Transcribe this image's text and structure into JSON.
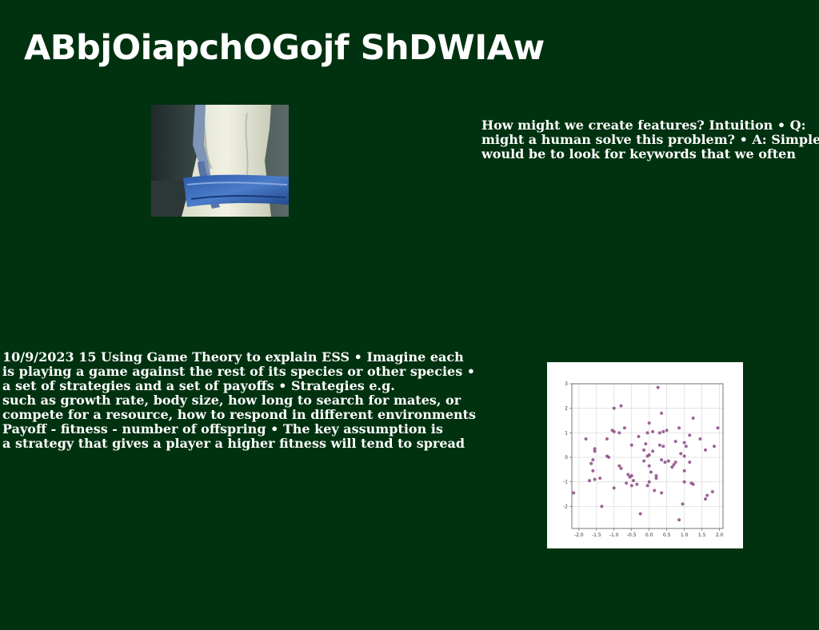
{
  "title": "ABbjOiapchOGojf ShDWIAw",
  "photo": {
    "icon": "photo-figure-white-robe-blue-fabric"
  },
  "text_right": {
    "lines": [
      "How might we create features? Intuition • Q:",
      "might a human solve this problem? • A: Simple",
      "would be to look for keywords that we often"
    ]
  },
  "text_left": {
    "lines": [
      "10/9/2023 15 Using Game Theory to explain ESS • Imagine each",
      "is playing a game against the rest of its species or other species •",
      "a set of strategies and a set of payoffs • Strategies e.g.",
      "such as growth rate, body size, how long to search for mates, or",
      "compete for a resource, how to respond in different environments",
      "Payoff - fitness - number of offspring • The key assumption is",
      "a strategy that gives a player a higher fitness will tend to spread"
    ]
  },
  "colors": {
    "background": "#013210",
    "point": "#8b4a86",
    "text": "#ffffff"
  },
  "chart_data": {
    "type": "scatter",
    "xlim": [
      -2.2,
      2.1
    ],
    "ylim": [
      -2.9,
      3.0
    ],
    "xticks": [
      "-2.0",
      "-1.5",
      "-1.0",
      "-0.5",
      "0.0",
      "0.5",
      "1.0",
      "1.5",
      "2.0"
    ],
    "xtick_values": [
      -2.0,
      -1.5,
      -1.0,
      -0.5,
      0.0,
      0.5,
      1.0,
      1.5,
      2.0
    ],
    "yticks": [
      "3",
      "2",
      "1",
      "0",
      "-1",
      "-2"
    ],
    "ytick_values": [
      3,
      2,
      1,
      0,
      -1,
      -2
    ],
    "grid": true,
    "points": [
      [
        0.25,
        2.85
      ],
      [
        -0.8,
        2.1
      ],
      [
        -1.0,
        2.0
      ],
      [
        0.35,
        1.8
      ],
      [
        1.25,
        1.6
      ],
      [
        0.0,
        1.4
      ],
      [
        -1.05,
        1.1
      ],
      [
        -0.7,
        1.2
      ],
      [
        0.85,
        1.2
      ],
      [
        1.95,
        1.2
      ],
      [
        0.1,
        1.05
      ],
      [
        0.4,
        1.05
      ],
      [
        0.5,
        1.1
      ],
      [
        0.3,
        1.0
      ],
      [
        -0.05,
        1.0
      ],
      [
        -0.85,
        1.0
      ],
      [
        -1.0,
        1.05
      ],
      [
        -1.8,
        0.75
      ],
      [
        -1.2,
        0.75
      ],
      [
        -0.3,
        0.85
      ],
      [
        1.15,
        0.9
      ],
      [
        1.45,
        0.75
      ],
      [
        0.75,
        0.65
      ],
      [
        1.0,
        0.6
      ],
      [
        1.05,
        0.45
      ],
      [
        -0.1,
        0.55
      ],
      [
        0.3,
        0.5
      ],
      [
        -0.5,
        0.5
      ],
      [
        0.4,
        0.45
      ],
      [
        1.85,
        0.45
      ],
      [
        1.6,
        0.3
      ],
      [
        -1.55,
        0.35
      ],
      [
        -1.55,
        0.25
      ],
      [
        -0.15,
        0.3
      ],
      [
        0.1,
        0.25
      ],
      [
        0.9,
        0.15
      ],
      [
        -1.2,
        0.05
      ],
      [
        -1.15,
        0.0
      ],
      [
        -0.05,
        0.05
      ],
      [
        0.0,
        0.1
      ],
      [
        1.0,
        0.05
      ],
      [
        0.35,
        -0.1
      ],
      [
        0.55,
        -0.15
      ],
      [
        0.75,
        -0.2
      ],
      [
        0.45,
        -0.2
      ],
      [
        0.7,
        -0.3
      ],
      [
        -1.6,
        -0.1
      ],
      [
        -1.65,
        -0.25
      ],
      [
        -0.85,
        -0.35
      ],
      [
        0.0,
        -0.35
      ],
      [
        -0.15,
        -0.15
      ],
      [
        1.15,
        -0.2
      ],
      [
        0.65,
        -0.4
      ],
      [
        -0.8,
        -0.45
      ],
      [
        -1.6,
        -0.55
      ],
      [
        0.05,
        -0.6
      ],
      [
        0.2,
        -0.75
      ],
      [
        0.2,
        -0.85
      ],
      [
        1.0,
        -0.55
      ],
      [
        -0.6,
        -0.7
      ],
      [
        -0.5,
        -0.75
      ],
      [
        -0.55,
        -0.8
      ],
      [
        -1.55,
        -0.9
      ],
      [
        -1.4,
        -0.85
      ],
      [
        -1.7,
        -0.95
      ],
      [
        -0.45,
        -0.95
      ],
      [
        -0.35,
        -1.1
      ],
      [
        -0.65,
        -1.05
      ],
      [
        -0.5,
        -1.15
      ],
      [
        1.0,
        -1.0
      ],
      [
        1.2,
        -1.05
      ],
      [
        1.25,
        -1.1
      ],
      [
        0.0,
        -1.0
      ],
      [
        -0.05,
        -1.15
      ],
      [
        -1.0,
        -1.25
      ],
      [
        0.15,
        -1.35
      ],
      [
        0.35,
        -1.45
      ],
      [
        1.8,
        -1.4
      ],
      [
        1.65,
        -1.55
      ],
      [
        1.6,
        -1.7
      ],
      [
        -2.15,
        -1.45
      ],
      [
        -1.35,
        -2.0
      ],
      [
        0.95,
        -1.9
      ],
      [
        -0.25,
        -2.3
      ],
      [
        0.85,
        -2.55
      ]
    ]
  }
}
